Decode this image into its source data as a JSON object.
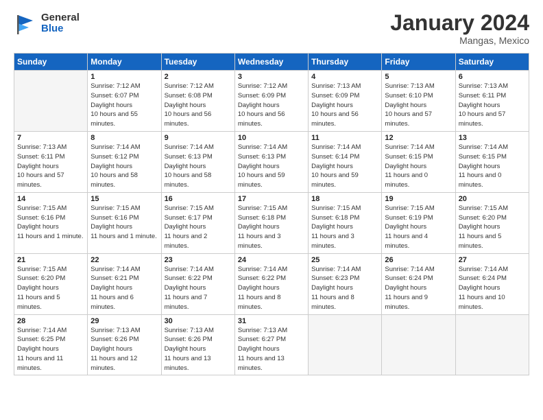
{
  "header": {
    "logo_general": "General",
    "logo_blue": "Blue",
    "month_year": "January 2024",
    "location": "Mangas, Mexico"
  },
  "days_of_week": [
    "Sunday",
    "Monday",
    "Tuesday",
    "Wednesday",
    "Thursday",
    "Friday",
    "Saturday"
  ],
  "weeks": [
    [
      {
        "day": "",
        "info": ""
      },
      {
        "day": "1",
        "sunrise": "7:12 AM",
        "sunset": "6:07 PM",
        "daylight": "10 hours and 55 minutes."
      },
      {
        "day": "2",
        "sunrise": "7:12 AM",
        "sunset": "6:08 PM",
        "daylight": "10 hours and 56 minutes."
      },
      {
        "day": "3",
        "sunrise": "7:12 AM",
        "sunset": "6:09 PM",
        "daylight": "10 hours and 56 minutes."
      },
      {
        "day": "4",
        "sunrise": "7:13 AM",
        "sunset": "6:09 PM",
        "daylight": "10 hours and 56 minutes."
      },
      {
        "day": "5",
        "sunrise": "7:13 AM",
        "sunset": "6:10 PM",
        "daylight": "10 hours and 57 minutes."
      },
      {
        "day": "6",
        "sunrise": "7:13 AM",
        "sunset": "6:11 PM",
        "daylight": "10 hours and 57 minutes."
      }
    ],
    [
      {
        "day": "7",
        "sunrise": "7:13 AM",
        "sunset": "6:11 PM",
        "daylight": "10 hours and 57 minutes."
      },
      {
        "day": "8",
        "sunrise": "7:14 AM",
        "sunset": "6:12 PM",
        "daylight": "10 hours and 58 minutes."
      },
      {
        "day": "9",
        "sunrise": "7:14 AM",
        "sunset": "6:13 PM",
        "daylight": "10 hours and 58 minutes."
      },
      {
        "day": "10",
        "sunrise": "7:14 AM",
        "sunset": "6:13 PM",
        "daylight": "10 hours and 59 minutes."
      },
      {
        "day": "11",
        "sunrise": "7:14 AM",
        "sunset": "6:14 PM",
        "daylight": "10 hours and 59 minutes."
      },
      {
        "day": "12",
        "sunrise": "7:14 AM",
        "sunset": "6:15 PM",
        "daylight": "11 hours and 0 minutes."
      },
      {
        "day": "13",
        "sunrise": "7:14 AM",
        "sunset": "6:15 PM",
        "daylight": "11 hours and 0 minutes."
      }
    ],
    [
      {
        "day": "14",
        "sunrise": "7:15 AM",
        "sunset": "6:16 PM",
        "daylight": "11 hours and 1 minute."
      },
      {
        "day": "15",
        "sunrise": "7:15 AM",
        "sunset": "6:16 PM",
        "daylight": "11 hours and 1 minute."
      },
      {
        "day": "16",
        "sunrise": "7:15 AM",
        "sunset": "6:17 PM",
        "daylight": "11 hours and 2 minutes."
      },
      {
        "day": "17",
        "sunrise": "7:15 AM",
        "sunset": "6:18 PM",
        "daylight": "11 hours and 3 minutes."
      },
      {
        "day": "18",
        "sunrise": "7:15 AM",
        "sunset": "6:18 PM",
        "daylight": "11 hours and 3 minutes."
      },
      {
        "day": "19",
        "sunrise": "7:15 AM",
        "sunset": "6:19 PM",
        "daylight": "11 hours and 4 minutes."
      },
      {
        "day": "20",
        "sunrise": "7:15 AM",
        "sunset": "6:20 PM",
        "daylight": "11 hours and 5 minutes."
      }
    ],
    [
      {
        "day": "21",
        "sunrise": "7:15 AM",
        "sunset": "6:20 PM",
        "daylight": "11 hours and 5 minutes."
      },
      {
        "day": "22",
        "sunrise": "7:14 AM",
        "sunset": "6:21 PM",
        "daylight": "11 hours and 6 minutes."
      },
      {
        "day": "23",
        "sunrise": "7:14 AM",
        "sunset": "6:22 PM",
        "daylight": "11 hours and 7 minutes."
      },
      {
        "day": "24",
        "sunrise": "7:14 AM",
        "sunset": "6:22 PM",
        "daylight": "11 hours and 8 minutes."
      },
      {
        "day": "25",
        "sunrise": "7:14 AM",
        "sunset": "6:23 PM",
        "daylight": "11 hours and 8 minutes."
      },
      {
        "day": "26",
        "sunrise": "7:14 AM",
        "sunset": "6:24 PM",
        "daylight": "11 hours and 9 minutes."
      },
      {
        "day": "27",
        "sunrise": "7:14 AM",
        "sunset": "6:24 PM",
        "daylight": "11 hours and 10 minutes."
      }
    ],
    [
      {
        "day": "28",
        "sunrise": "7:14 AM",
        "sunset": "6:25 PM",
        "daylight": "11 hours and 11 minutes."
      },
      {
        "day": "29",
        "sunrise": "7:13 AM",
        "sunset": "6:26 PM",
        "daylight": "11 hours and 12 minutes."
      },
      {
        "day": "30",
        "sunrise": "7:13 AM",
        "sunset": "6:26 PM",
        "daylight": "11 hours and 13 minutes."
      },
      {
        "day": "31",
        "sunrise": "7:13 AM",
        "sunset": "6:27 PM",
        "daylight": "11 hours and 13 minutes."
      },
      {
        "day": "",
        "info": ""
      },
      {
        "day": "",
        "info": ""
      },
      {
        "day": "",
        "info": ""
      }
    ]
  ]
}
